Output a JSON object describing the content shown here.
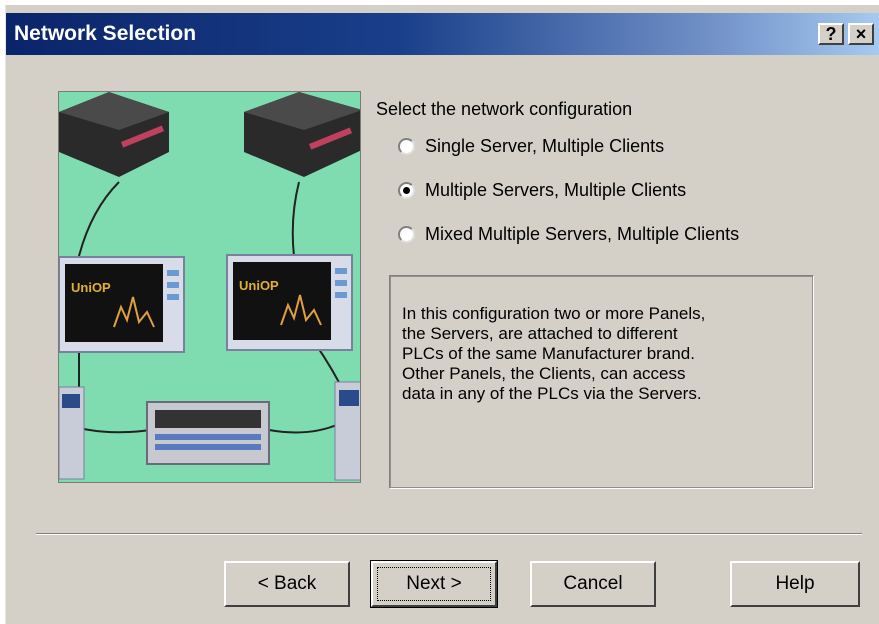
{
  "window": {
    "title": "Network Selection",
    "help_button_label": "?",
    "close_button_label": "×"
  },
  "illustration": {
    "alt": "network diagram of PLCs and panels",
    "panel_screen_text": "UniOP"
  },
  "config": {
    "label": "Select the network configuration",
    "options": [
      {
        "label": "Single Server, Multiple Clients",
        "selected": false
      },
      {
        "label": "Multiple Servers, Multiple Clients",
        "selected": true
      },
      {
        "label": "Mixed Multiple Servers, Multiple Clients",
        "selected": false
      }
    ]
  },
  "description": {
    "lines": [
      "In this configuration two or more Panels,",
      "the Servers, are attached to different",
      "PLCs of the same Manufacturer brand.",
      "Other Panels, the Clients, can access",
      "data in any of the PLCs via the Servers."
    ]
  },
  "buttons": {
    "back": "< Back",
    "next": "Next >",
    "cancel": "Cancel",
    "help": "Help"
  },
  "colors": {
    "title_gradient_start": "#0a246a",
    "title_gradient_end": "#a6caf0",
    "dialog_bg": "#d4d0c8",
    "illustration_bg": "#7fdcb0"
  }
}
